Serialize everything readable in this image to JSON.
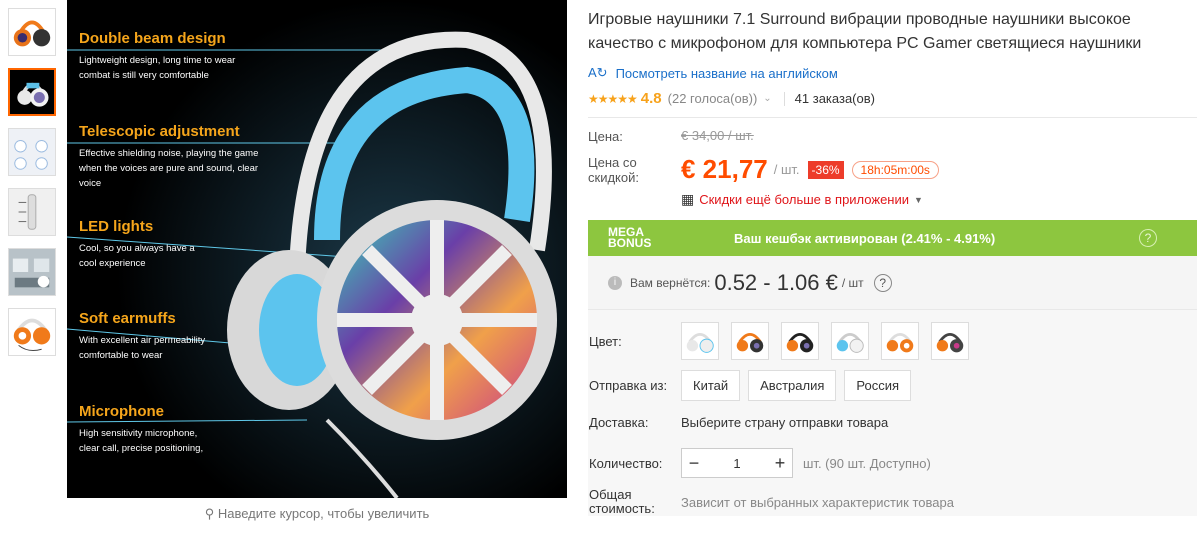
{
  "gallery": {
    "thumbnails": [
      "thumb-1",
      "thumb-2",
      "thumb-3",
      "thumb-4",
      "thumb-5",
      "thumb-6"
    ],
    "active_index": 1,
    "features": [
      {
        "title": "Double beam design",
        "desc": "Lightweight design, long time to wear combat is still very comfortable"
      },
      {
        "title": "Telescopic adjustment",
        "desc": "Effective shielding noise, playing the game when the voices are pure and sound, clear voice"
      },
      {
        "title": "LED lights",
        "desc": "Cool, so you always have a cool experience"
      },
      {
        "title": "Soft earmuffs",
        "desc": "With excellent air permeability comfortable to wear"
      },
      {
        "title": "Microphone",
        "desc": "High sensitivity microphone, clear call, precise positioning,"
      }
    ],
    "zoom_hint": "Наведите курсор, чтобы увеличить"
  },
  "product": {
    "title": "Игровые наушники 7.1 Surround вибрации проводные наушники высокое качество с микрофоном для компьютера PC Gamer светящиеся наушники",
    "translate_link": "Посмотреть название на английском",
    "stars": "★★★★★",
    "rating": "4.8",
    "votes": "(22 голоса(ов))",
    "orders": "41 заказа(ов)"
  },
  "price": {
    "label": "Цена:",
    "original": "€ 34,00 / шт.",
    "discount_label": "Цена со скидкой:",
    "current": "€ 21,77",
    "unit": "/ шт.",
    "discount": "-36%",
    "timer": "18h:05m:00s",
    "app_discount": "Скидки ещё больше в приложении"
  },
  "mega_bonus": {
    "logo_line1": "MEGA",
    "logo_line2": "BONUS",
    "text": "Ваш кешбэк активирован (2.41% - 4.91%)",
    "help": "?",
    "return_label": "Вам вернётся:",
    "return_value": "0.52 - 1.06 €",
    "return_unit": "/ шт"
  },
  "attributes": {
    "color_label": "Цвет:",
    "swatches": [
      "white-blue",
      "orange-black",
      "orange-black-2",
      "white-blue-2",
      "orange-white",
      "orange-black-3"
    ],
    "ship_from_label": "Отправка из:",
    "ship_from_options": [
      "Китай",
      "Австралия",
      "Россия"
    ],
    "delivery_label": "Доставка:",
    "delivery_value": "Выберите страну отправки товара",
    "qty_label": "Количество:",
    "qty_value": "1",
    "qty_minus": "−",
    "qty_plus": "+",
    "qty_note": "шт. (90 шт. Доступно)",
    "total_label": "Общая стоимость:",
    "total_value": "Зависит от выбранных характеристик товара"
  },
  "colors": {
    "accent": "#ff4c00",
    "link": "#1a6fc9",
    "mega_green": "#8dc63f",
    "feature_title": "#f5a51b",
    "discount_red": "#ed3c2a"
  }
}
